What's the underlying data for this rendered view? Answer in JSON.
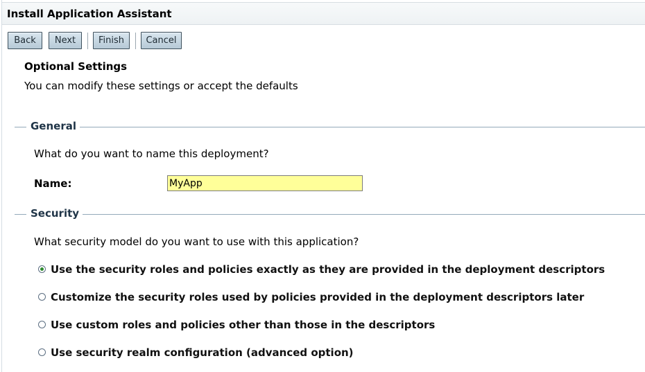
{
  "window": {
    "title": "Install Application Assistant"
  },
  "toolbar": {
    "back_label": "Back",
    "next_label": "Next",
    "finish_label": "Finish",
    "cancel_label": "Cancel"
  },
  "page": {
    "heading": "Optional Settings",
    "description": "You can modify these settings or accept the defaults"
  },
  "general": {
    "legend": "General",
    "question": "What do you want to name this deployment?",
    "name_label": "Name:",
    "name_value": "MyApp"
  },
  "security": {
    "legend": "Security",
    "question": "What security model do you want to use with this application?",
    "options": [
      {
        "label": "Use the security roles and policies exactly as they are provided in the deployment descriptors",
        "selected": true
      },
      {
        "label": "Customize the security roles used by policies provided in the deployment descriptors later",
        "selected": false
      },
      {
        "label": "Use custom roles and policies other than those in the descriptors",
        "selected": false
      },
      {
        "label": "Use security realm configuration (advanced option)",
        "selected": false
      }
    ]
  },
  "colors": {
    "input_background": "#ffff99",
    "section_line": "#93a9b9",
    "button_gradient_top": "#d9e6ef",
    "button_gradient_bottom": "#b6c9d6",
    "radio_selected_dot": "#2e8b2e"
  }
}
